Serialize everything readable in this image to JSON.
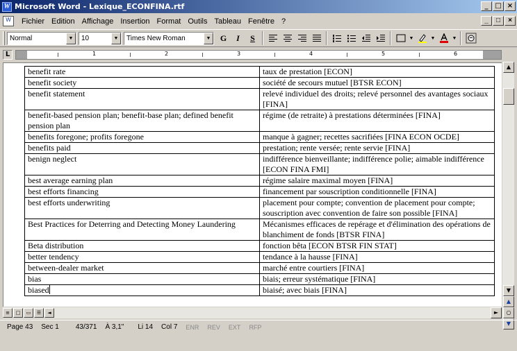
{
  "window": {
    "title": "Microsoft Word - Lexique_ECONFINA.rtf",
    "app_icon": "W",
    "minimize_label": "_",
    "maximize_label": "□",
    "close_label": "×"
  },
  "menu": {
    "items": [
      "Fichier",
      "Edition",
      "Affichage",
      "Insertion",
      "Format",
      "Outils",
      "Tableau",
      "Fenêtre",
      "?"
    ]
  },
  "toolbar": {
    "style": "Normal",
    "size": "10",
    "font": "Times New Roman",
    "bold_label": "G",
    "italic_label": "I",
    "underline_label": "S"
  },
  "ruler": {
    "numbers": [
      "1",
      "2",
      "3",
      "4",
      "5",
      "6"
    ]
  },
  "table": {
    "rows": [
      [
        "benefit rate",
        "taux de prestation [ECON]"
      ],
      [
        "benefit society",
        "société de secours mutuel [BTSR ECON]"
      ],
      [
        "benefit statement",
        "relevé individuel des droits; relevé personnel des avantages sociaux [FINA]"
      ],
      [
        "benefit-based pension plan; benefit-base plan; defined benefit pension plan",
        "régime (de retraite) à prestations déterminées [FINA]"
      ],
      [
        "benefits foregone; profits foregone",
        "manque à gagner; recettes sacrifiées [FINA ECON OCDE]"
      ],
      [
        "benefits paid",
        "prestation; rente versée; rente servie [FINA]"
      ],
      [
        "benign neglect",
        "indifférence bienveillante; indifférence polie; aimable indifférence [ECON FINA FMI]"
      ],
      [
        "best average earning plan",
        "régime salaire maximal moyen [FINA]"
      ],
      [
        "best efforts financing",
        "financement par souscription conditionnelle [FINA]"
      ],
      [
        "best efforts underwriting",
        "placement pour compte; convention de placement pour compte; souscription avec convention de faire son possible [FINA]"
      ],
      [
        "Best Practices for Deterring and Detecting Money Laundering",
        "Mécanismes efficaces de repérage et d'élimination des opérations de blanchiment de fonds [BTSR FINA]"
      ],
      [
        "Beta distribution",
        "fonction bêta [ECON BTSR FIN STAT]"
      ],
      [
        "better tendency",
        "tendance à la hausse [FINA]"
      ],
      [
        "between-dealer market",
        "marché entre courtiers [FINA]"
      ],
      [
        "bias",
        "biais; erreur systématique [FINA]"
      ],
      [
        "biased",
        "biaisé; avec biais [FINA]"
      ]
    ]
  },
  "status": {
    "page": "Page 43",
    "section": "Sec 1",
    "pages": "43/371",
    "position": "À 3,1\"",
    "line": "Li 14",
    "col": "Col 7",
    "enr": "ENR",
    "rev": "REV",
    "ext": "EXT",
    "rfp": "RFP"
  }
}
